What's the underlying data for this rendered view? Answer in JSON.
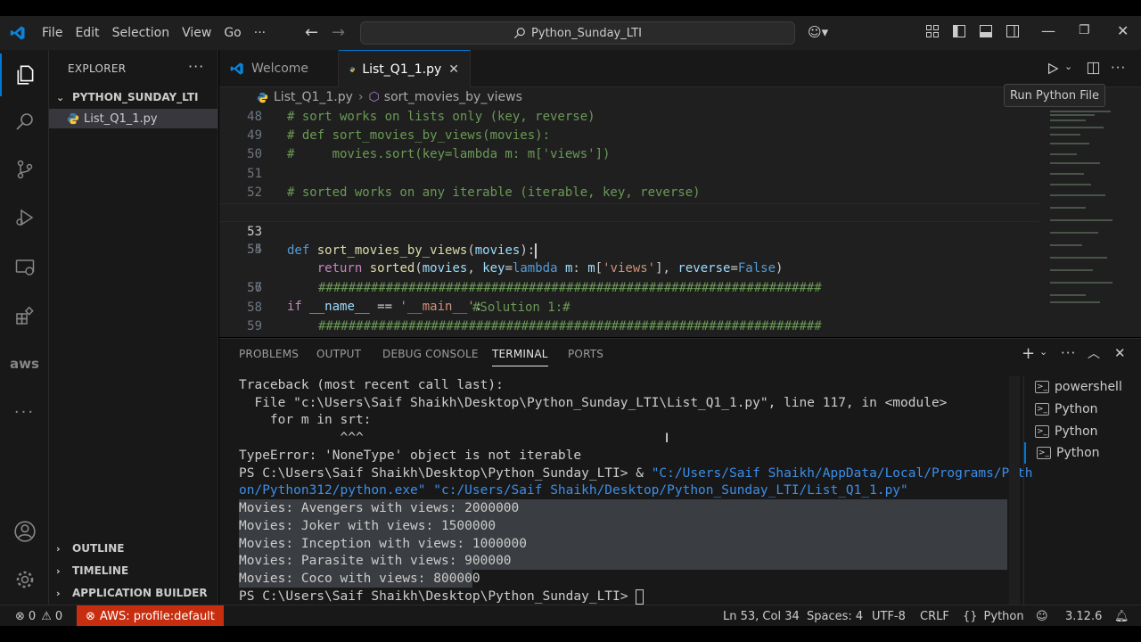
{
  "menu": [
    "File",
    "Edit",
    "Selection",
    "View",
    "Go",
    "···"
  ],
  "command_center": "Python_Sunday_LTI",
  "sidebar": {
    "title": "EXPLORER",
    "folder": "PYTHON_SUNDAY_LTI",
    "file": "List_Q1_1.py",
    "sections": [
      "OUTLINE",
      "TIMELINE",
      "APPLICATION BUILDER"
    ]
  },
  "tabs": [
    {
      "label": "Welcome"
    },
    {
      "label": "List_Q1_1.py"
    }
  ],
  "breadcrumb": {
    "file": "List_Q1_1.py",
    "symbol": "sort_movies_by_views"
  },
  "tooltip": "Run Python File",
  "code": {
    "line_numbers": [
      "48",
      "49",
      "50",
      "51",
      "52",
      "53",
      "54",
      "55",
      "56",
      "57",
      "58",
      "59"
    ],
    "l48": "# sort works on lists only (key, reverse)",
    "l49": "# def sort_movies_by_views(movies):",
    "l50": "#     movies.sort(key=lambda m: m['views'])",
    "l52": "# sorted works on any iterable (iterable, key, reverse)",
    "l53_def": "def",
    "l53_fn": "sort_movies_by_views",
    "l53_arg": "movies",
    "l54_ret": "return",
    "l54_fn": "sorted",
    "l54_arg": "movies",
    "l54_key": "key",
    "l54_lambda": "lambda",
    "l54_m": "m",
    "l54_m2": "m",
    "l54_str": "'views'",
    "l54_rev": "reverse",
    "l54_false": "False",
    "l56_if": "if",
    "l56_name": "__name__",
    "l56_str": "'__main__'",
    "l57": "###################################################################",
    "l58": "#Solution 1:#",
    "l59": "###################################################################"
  },
  "panel": {
    "tabs": [
      "PROBLEMS",
      "OUTPUT",
      "DEBUG CONSOLE",
      "TERMINAL",
      "PORTS"
    ],
    "active_tab": "TERMINAL",
    "terminal": {
      "t1": "Traceback (most recent call last):",
      "t2": "  File \"c:\\Users\\Saif Shaikh\\Desktop\\Python_Sunday_LTI\\List_Q1_1.py\", line 117, in <module>",
      "t3": "    for m in srt:",
      "t4": "             ^^^",
      "t5": "TypeError: 'NoneType' object is not iterable",
      "t6a": "PS C:\\Users\\Saif Shaikh\\Desktop\\Python_Sunday_LTI> & ",
      "t6b": "\"C:/Users/Saif Shaikh/AppData/Local/Programs/Pyth",
      "t7a": "on/Python312/python.exe\"",
      "t7b": " \"c:/Users/Saif Shaikh/Desktop/Python_Sunday_LTI/List_Q1_1.py\"",
      "t8": "Movies: Avengers with views: 2000000",
      "t9": "Movies: Joker with views: 1500000",
      "t10": "Movies: Inception with views: 1000000",
      "t11": "Movies: Parasite with views: 900000",
      "t12": "Movies: Coco with views: 800000",
      "t13": "PS C:\\Users\\Saif Shaikh\\Desktop\\Python_Sunday_LTI> "
    },
    "terminals": [
      "powershell",
      "Python",
      "Python",
      "Python"
    ]
  },
  "status": {
    "errors": "0",
    "warnings": "0",
    "aws": "AWS: profile:default",
    "position": "Ln 53, Col 34",
    "spaces": "Spaces: 4",
    "encoding": "UTF-8",
    "eol": "CRLF",
    "language": "Python",
    "version": "3.12.6"
  },
  "colors": {
    "accent": "#0078d4",
    "aws_badge": "#c72e0f",
    "comment": "#6a9955",
    "keyword": "#569cd6"
  }
}
